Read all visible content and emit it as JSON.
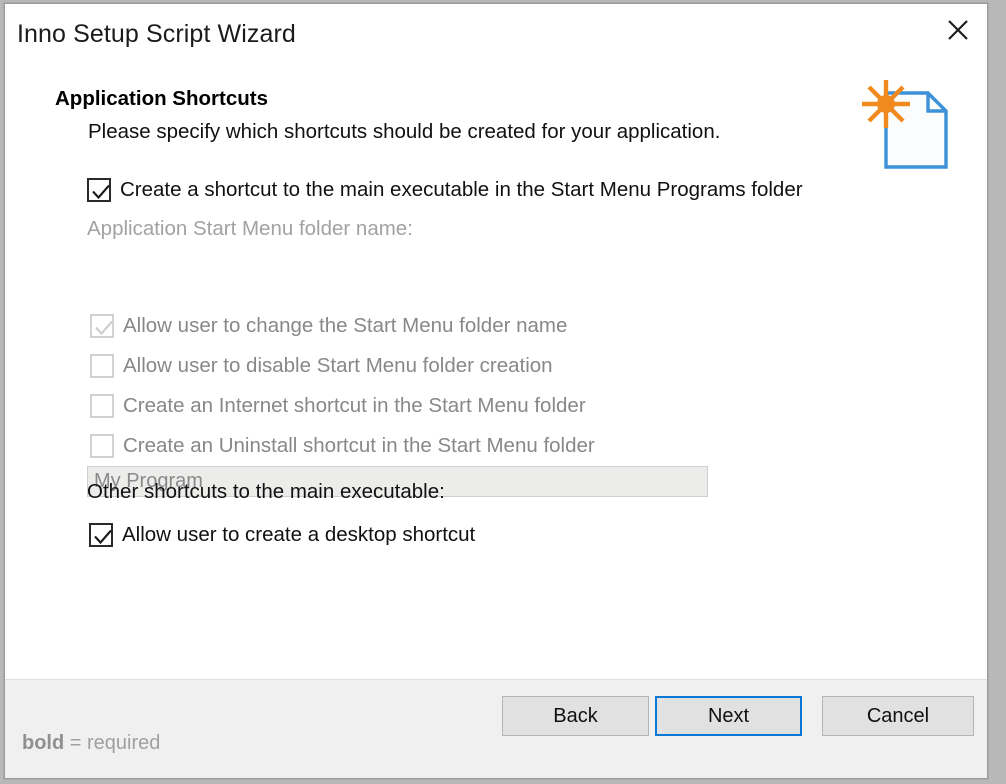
{
  "window": {
    "title": "Inno Setup Script Wizard",
    "close_icon": "close-icon"
  },
  "header": {
    "heading": "Application Shortcuts",
    "subtitle": "Please specify which shortcuts should be created for your application.",
    "icon": "document-sparkle-icon",
    "icon_colors": {
      "document": "#3c91d8",
      "sparkle": "#f08a1e"
    }
  },
  "form": {
    "main_checkbox": {
      "label": "Create a shortcut to the main executable in the Start Menu Programs folder",
      "checked": true,
      "enabled": true
    },
    "folder_name_label": {
      "text": "Application Start Menu folder name:",
      "enabled": false
    },
    "folder_name_input": {
      "value": "My Program",
      "placeholder": "My Program",
      "enabled": false
    },
    "options": [
      {
        "label": "Allow user to change the Start Menu folder name",
        "checked": true,
        "enabled": false
      },
      {
        "label": "Allow user to disable Start Menu folder creation",
        "checked": false,
        "enabled": false
      },
      {
        "label": "Create an Internet shortcut in the Start Menu folder",
        "checked": false,
        "enabled": false
      },
      {
        "label": "Create an Uninstall shortcut in the Start Menu folder",
        "checked": false,
        "enabled": false
      }
    ],
    "other_shortcuts_label": "Other shortcuts to the main executable:",
    "desktop_checkbox": {
      "label": "Allow user to create a desktop shortcut",
      "checked": true,
      "enabled": true
    }
  },
  "footer": {
    "required_note_bold": "bold",
    "required_note_rest": " = required",
    "buttons": {
      "back": "Back",
      "next": "Next",
      "cancel": "Cancel"
    },
    "focus_color": "#0a78d4"
  }
}
